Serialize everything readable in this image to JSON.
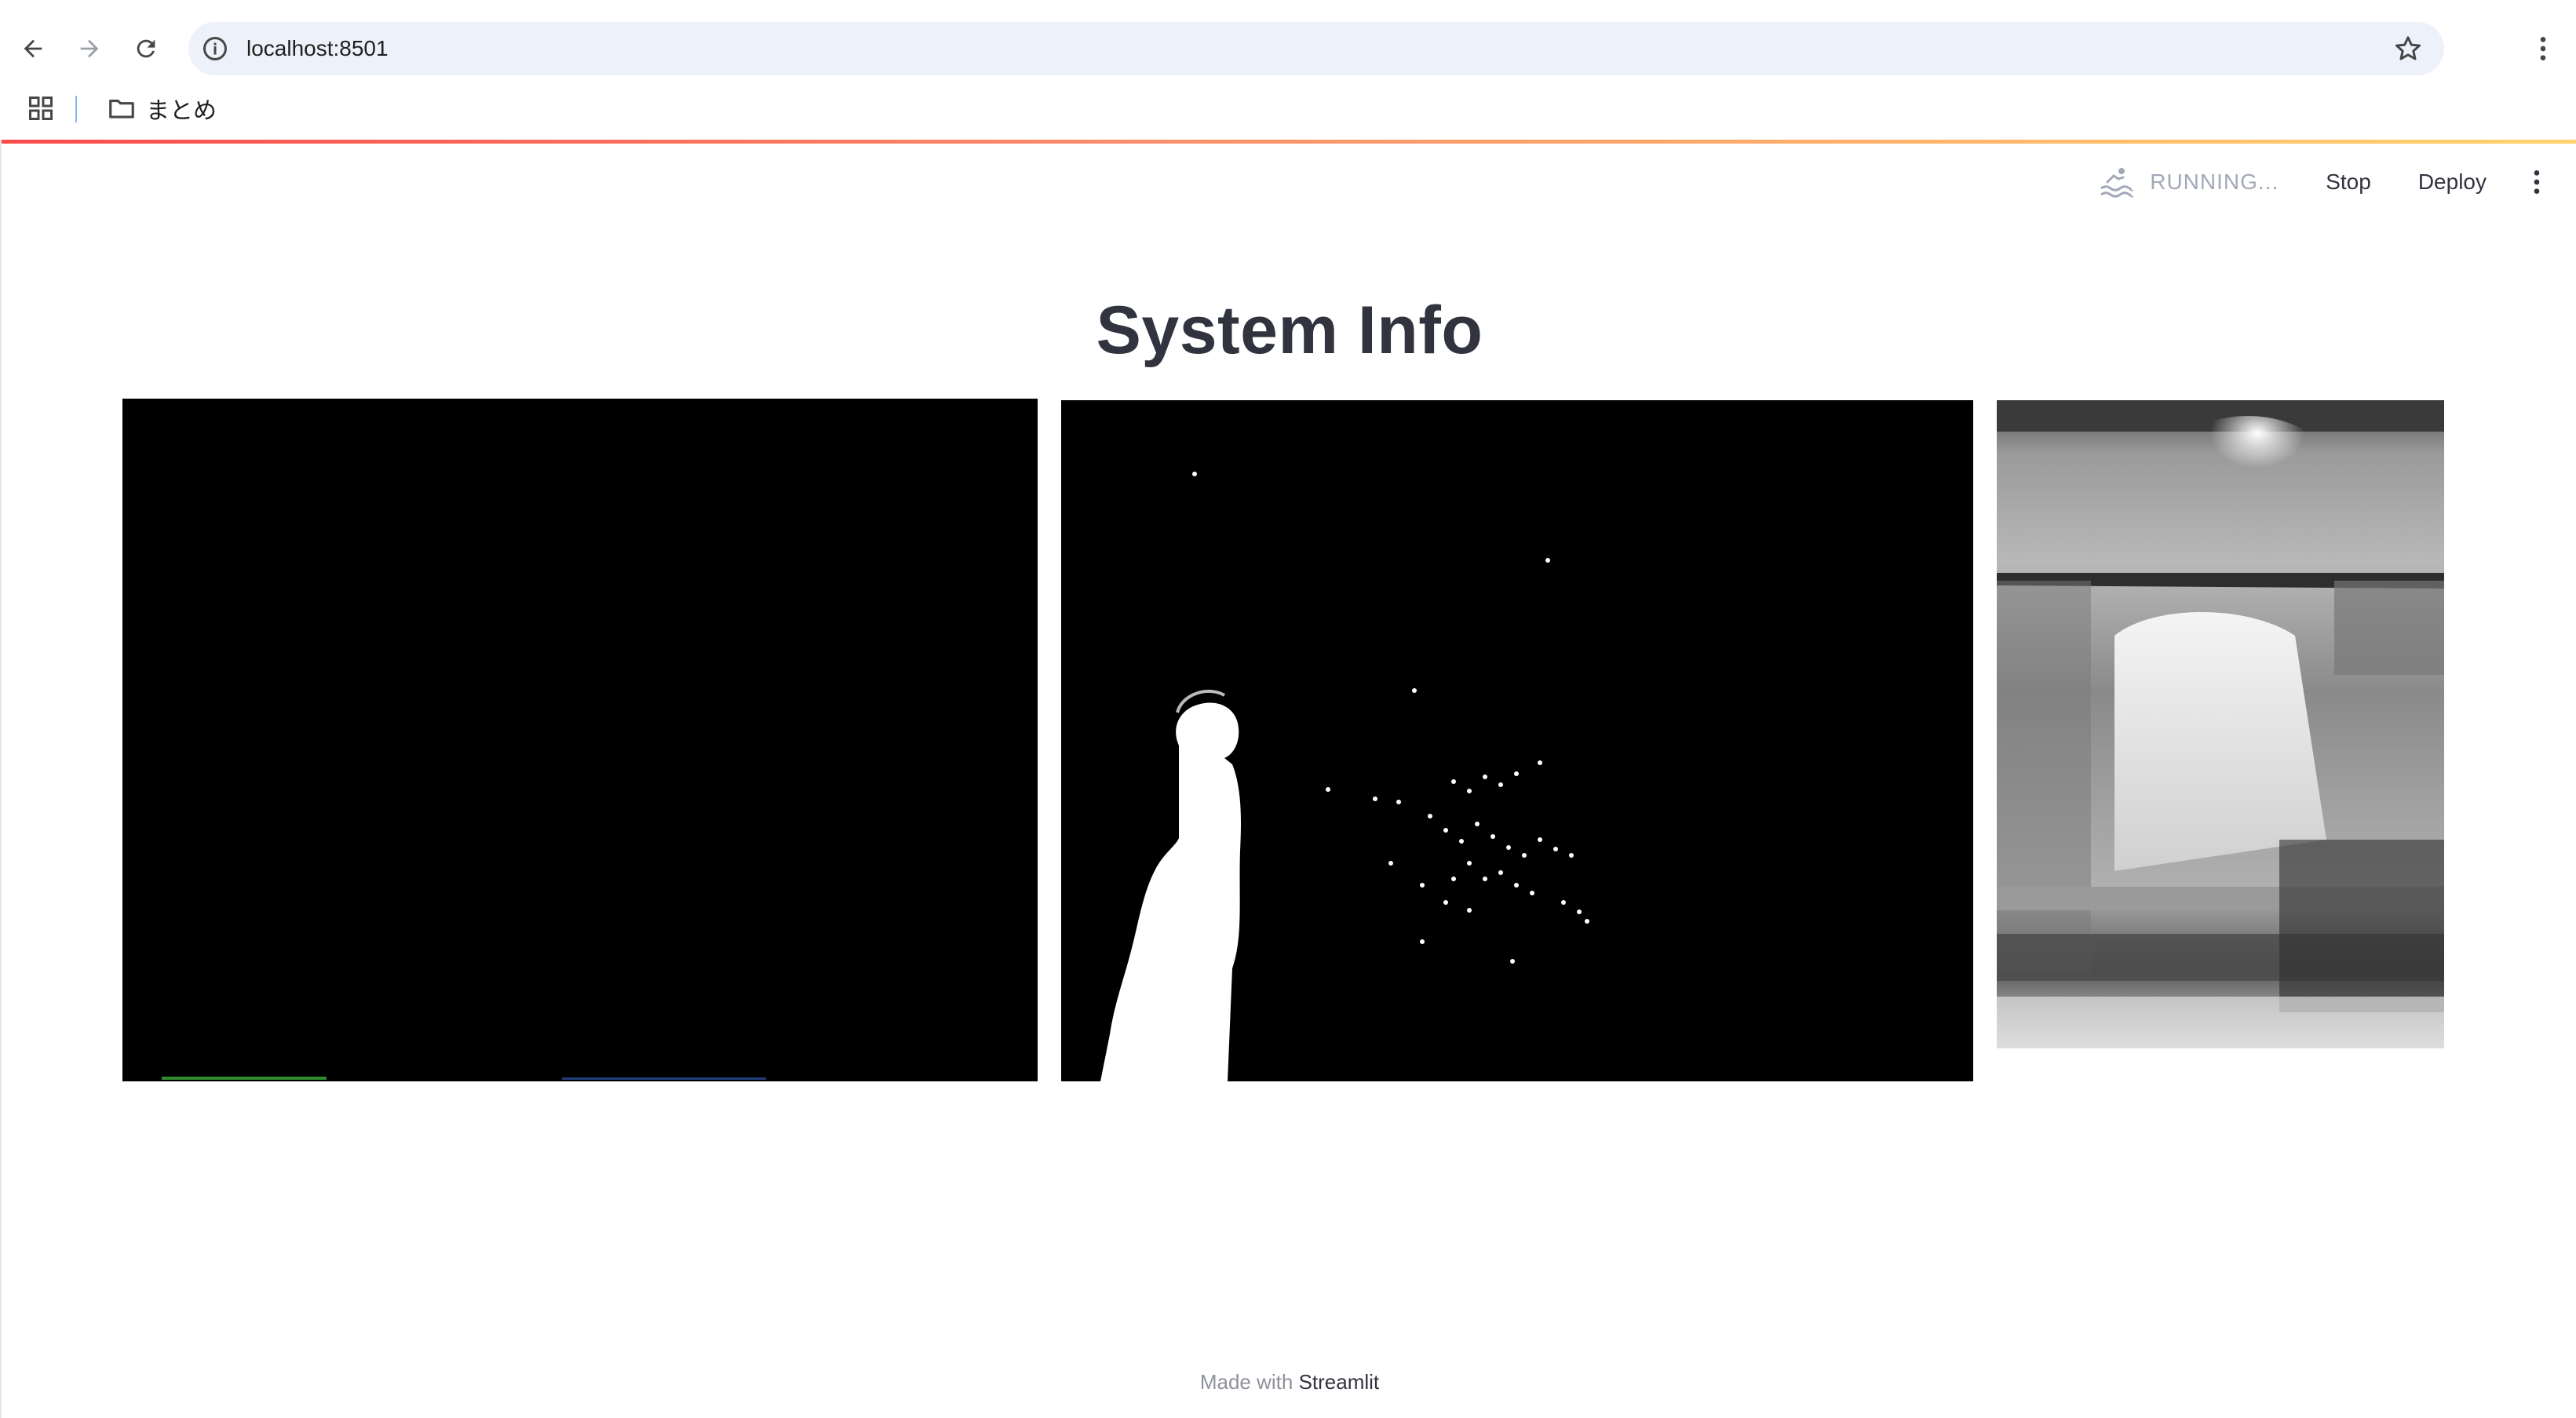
{
  "browser": {
    "url": "localhost:8501",
    "bookmarks": [
      {
        "label": "まとめ",
        "icon": "folder-icon"
      }
    ],
    "icons": {
      "back": "back-arrow-icon",
      "forward": "forward-arrow-icon",
      "reload": "reload-icon",
      "site_info": "info-icon",
      "bookmark": "star-icon",
      "menu": "kebab-menu-icon",
      "apps": "apps-grid-icon"
    }
  },
  "app": {
    "header": {
      "status_label": "RUNNING...",
      "stop_label": "Stop",
      "deploy_label": "Deploy",
      "status_icon": "running-swimmer-icon"
    },
    "title": "System Info",
    "images": [
      {
        "name": "camera-frame",
        "description_hidden": true
      },
      {
        "name": "foreground-mask",
        "description_hidden": true
      },
      {
        "name": "depth-map",
        "description_hidden": true
      }
    ],
    "footer": {
      "prefix": "Made with",
      "brand": "Streamlit"
    }
  },
  "colors": {
    "accent_gradient_start": "#ff4b4b",
    "accent_gradient_end": "#ffd36b",
    "text_primary": "#31333f",
    "text_muted": "#a3a8b8",
    "omnibox_bg": "#edf1f9"
  }
}
